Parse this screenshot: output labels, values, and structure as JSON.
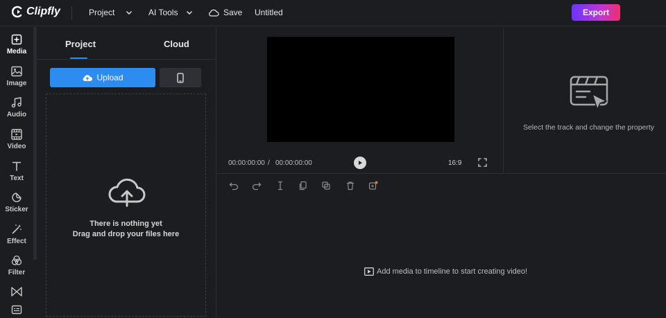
{
  "app": {
    "name": "Clipfly"
  },
  "header": {
    "menu": [
      {
        "label": "Project"
      },
      {
        "label": "AI Tools"
      }
    ],
    "save_label": "Save",
    "doc_title": "Untitled",
    "export_label": "Export"
  },
  "sidebar": {
    "items": [
      {
        "label": "Media",
        "icon": "media-add-icon"
      },
      {
        "label": "Image",
        "icon": "image-icon"
      },
      {
        "label": "Audio",
        "icon": "music-note-icon"
      },
      {
        "label": "Video",
        "icon": "film-icon"
      },
      {
        "label": "Text",
        "icon": "text-t-icon"
      },
      {
        "label": "Sticker",
        "icon": "sticker-icon"
      },
      {
        "label": "Effect",
        "icon": "magic-wand-icon"
      },
      {
        "label": "Filter",
        "icon": "filter-circles-icon"
      },
      {
        "label": "",
        "icon": "transition-icon"
      },
      {
        "label": "",
        "icon": "subtitle-icon"
      }
    ]
  },
  "media_panel": {
    "tabs": [
      {
        "label": "Project"
      },
      {
        "label": "Cloud"
      }
    ],
    "upload_label": "Upload",
    "empty_line1": "There is nothing yet",
    "empty_line2": "Drag and drop your files here"
  },
  "preview": {
    "current_time": "00:00:00:00",
    "separator": "/",
    "total_time": "00:00:00:00",
    "aspect_ratio": "16:9"
  },
  "properties": {
    "hint": "Select the track and change the property"
  },
  "timeline": {
    "tools": [
      "undo-icon",
      "redo-icon",
      "split-icon",
      "copy-icon",
      "duplicate-icon",
      "delete-icon",
      "ai-tool-icon"
    ],
    "empty_message": "Add media to timeline to start creating video!"
  },
  "colors": {
    "background": "#1c1d21",
    "accent_blue": "#2d8cf0",
    "export_gradient_start": "#6a35ff",
    "export_gradient_end": "#f0306a"
  }
}
